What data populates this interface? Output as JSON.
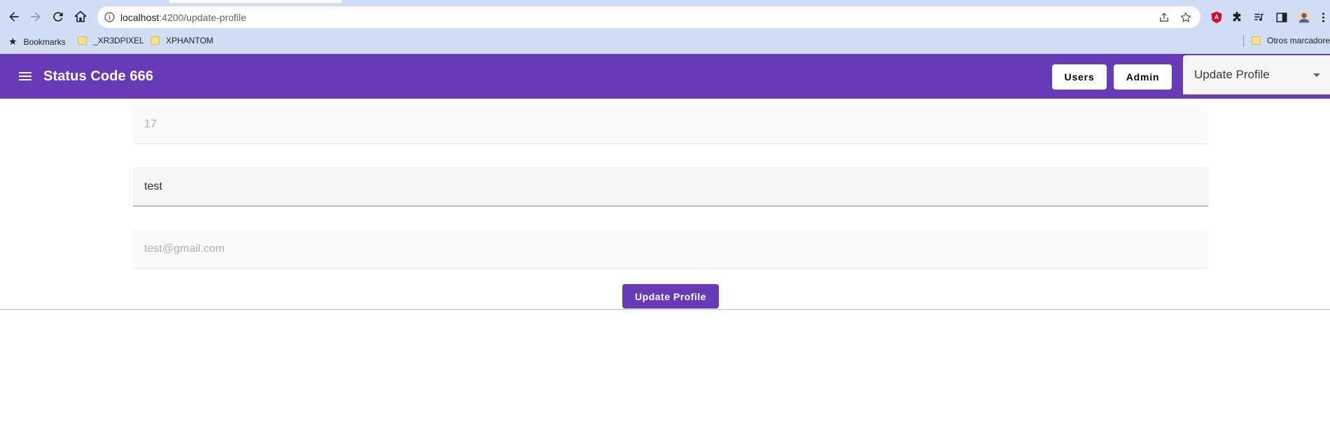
{
  "browser": {
    "url_host": "localhost",
    "url_path": ":4200/update-profile",
    "bookmarks": [
      {
        "label": "Bookmarks",
        "icon": "star-icon"
      },
      {
        "label": "_XR3DPIXEL",
        "icon": "folder-icon"
      },
      {
        "label": "XPHANTOM",
        "icon": "folder-icon"
      }
    ],
    "other_bookmarks": "Otros marcadores"
  },
  "appbar": {
    "title": "Status Code 666",
    "users_label": "Users",
    "admin_label": "Admin",
    "select_value": "Update Profile",
    "color": "#673ab7"
  },
  "form": {
    "id_value": "17",
    "name_value": "test",
    "email_value": "test@gmail.com",
    "submit_label": "Update Profile"
  }
}
